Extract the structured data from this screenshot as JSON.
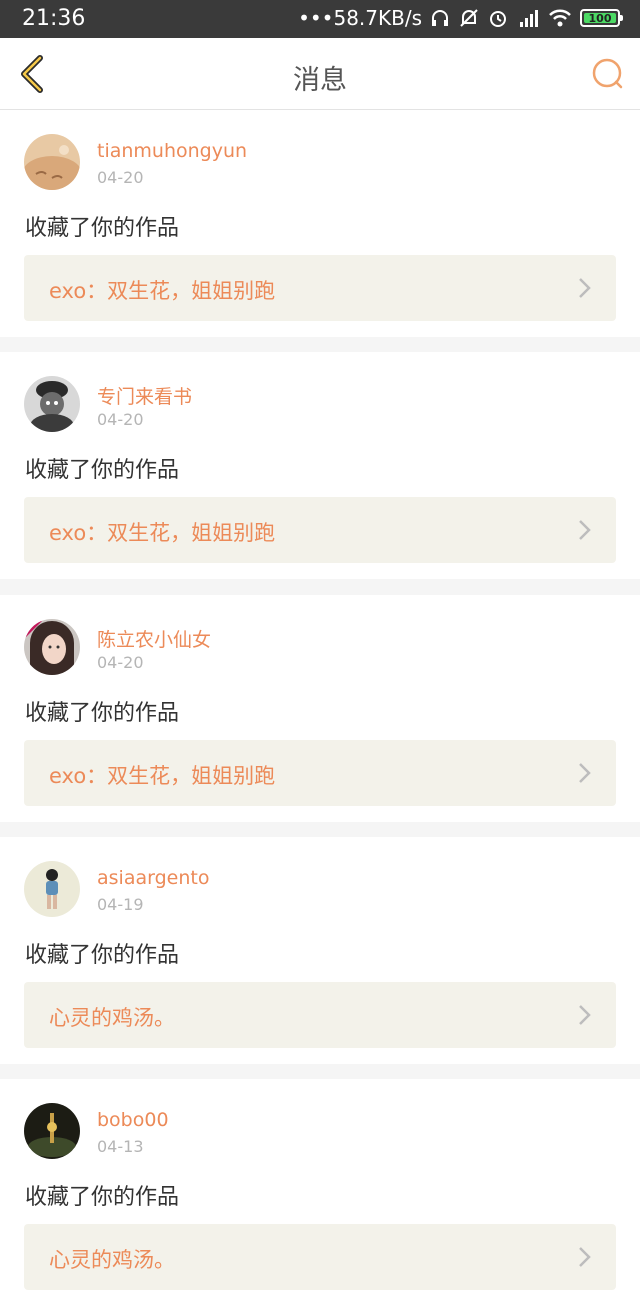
{
  "status_bar": {
    "time": "21:36",
    "network_speed": "•••58.7KB/s",
    "battery": "100"
  },
  "header": {
    "title": "消息",
    "accent_color": "#ec8a58"
  },
  "messages": [
    {
      "username": "tianmuhongyun",
      "date": "04-20",
      "action": "收藏了你的作品",
      "work_title": "exo：双生花，姐姐别跑"
    },
    {
      "username": "专门来看书",
      "date": "04-20",
      "action": "收藏了你的作品",
      "work_title": "exo：双生花，姐姐别跑"
    },
    {
      "username": "陈立农小仙女",
      "date": "04-20",
      "action": "收藏了你的作品",
      "work_title": "exo：双生花，姐姐别跑"
    },
    {
      "username": "asiaargento",
      "date": "04-19",
      "action": "收藏了你的作品",
      "work_title": "心灵的鸡汤。"
    },
    {
      "username": "bobo00",
      "date": "04-13",
      "action": "收藏了你的作品",
      "work_title": "心灵的鸡汤。"
    }
  ]
}
